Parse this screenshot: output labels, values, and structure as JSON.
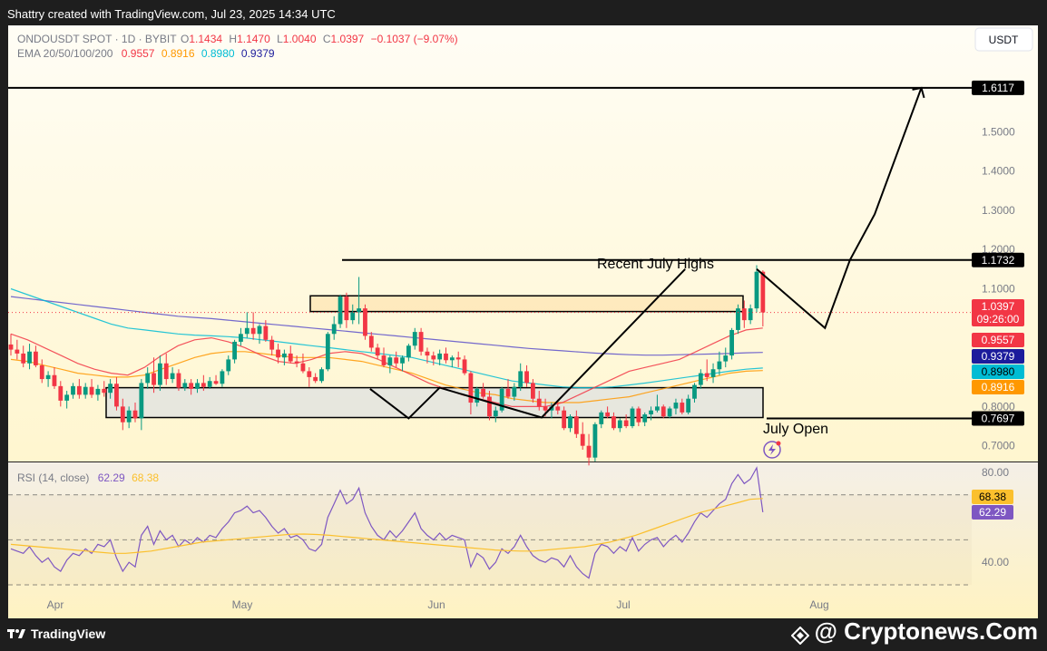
{
  "header": {
    "credit": "Shattry created with TradingView.com, Jul 23, 2025 14:34 UTC"
  },
  "legend": {
    "symbol_line": "ONDOUSDT SPOT · 1D · BYBIT",
    "ohlc": [
      {
        "label": "O",
        "value": "1.1434"
      },
      {
        "label": "H",
        "value": "1.1470"
      },
      {
        "label": "L",
        "value": "1.0040"
      },
      {
        "label": "C",
        "value": "1.0397"
      }
    ],
    "change": "−0.1037 (−9.07%)",
    "ema_label": "EMA 20/50/100/200",
    "ema_values": [
      {
        "value": "0.9557",
        "color": "#f23645"
      },
      {
        "value": "0.8916",
        "color": "#ff9800"
      },
      {
        "value": "0.8980",
        "color": "#00bcd4"
      },
      {
        "value": "0.9379",
        "color": "#1c1c9c"
      }
    ],
    "rsi_label": "RSI (14, close)",
    "rsi_values": [
      {
        "value": "62.29",
        "color": "#7e57c2"
      },
      {
        "value": "68.38",
        "color": "#fbc02d"
      }
    ]
  },
  "currency_button": "USDT",
  "colors": {
    "up": "#089981",
    "down": "#f23645",
    "ema20": "#f23645",
    "ema50": "#ff9800",
    "ema100": "#00bcd4",
    "ema200": "#5b4fc9",
    "rsi": "#7e57c2",
    "rsi_ma": "#fbc02d",
    "resistance_box": "#fde4b3",
    "support_box": "#dfe2e2"
  },
  "annotations": {
    "recent_highs": "Recent July Highs",
    "july_open": "July Open"
  },
  "chart_data": {
    "type": "candlestick",
    "title": "ONDOUSDT SPOT · 1D · BYBIT",
    "x_ticks": [
      "Apr",
      "May",
      "Jun",
      "Jul",
      "Aug"
    ],
    "price_axis": {
      "ticks": [
        "1.5000",
        "1.4000",
        "1.3000",
        "1.2000",
        "1.1000",
        "0.8000",
        "0.7000"
      ],
      "ylim": [
        0.66,
        1.66
      ]
    },
    "price_labels": [
      {
        "value": "1.6117",
        "bg": "#000000",
        "fg": "#ffffff"
      },
      {
        "value": "1.1732",
        "bg": "#000000",
        "fg": "#ffffff"
      },
      {
        "value": "1.0397",
        "bg": "#f23645",
        "fg": "#ffffff",
        "sub": "09:26:00"
      },
      {
        "value": "0.9557",
        "bg": "#f23645",
        "fg": "#ffffff"
      },
      {
        "value": "0.9379",
        "bg": "#1c1c9c",
        "fg": "#ffffff"
      },
      {
        "value": "0.8980",
        "bg": "#00bcd4",
        "fg": "#000000"
      },
      {
        "value": "0.8916",
        "bg": "#ff9800",
        "fg": "#ffffff"
      },
      {
        "value": "0.7697",
        "bg": "#000000",
        "fg": "#ffffff"
      }
    ],
    "horizontal_levels": [
      1.6117,
      1.1732,
      0.7697
    ],
    "zones": [
      {
        "name": "resistance",
        "low": 1.042,
        "high": 1.082
      },
      {
        "name": "support",
        "low": 0.772,
        "high": 0.848
      }
    ],
    "projection_path": [
      {
        "date": "Jul 23",
        "price": 1.15
      },
      {
        "date": "Jul 26",
        "price": 1.0
      },
      {
        "date": "Jul 29",
        "price": 1.1732
      },
      {
        "date": "Aug 2",
        "price": 1.29
      },
      {
        "date": "Aug 5",
        "price": 1.6117
      }
    ],
    "pattern_path": [
      {
        "date": "Jun 1",
        "price": 0.845
      },
      {
        "date": "Jun 7",
        "price": 0.77
      },
      {
        "date": "Jun 12",
        "price": 0.848
      },
      {
        "date": "Jun 28",
        "price": 0.772
      },
      {
        "date": "Jul 21",
        "price": 1.15
      }
    ],
    "rsi_axis": {
      "ticks": [
        "80.00",
        "40.00"
      ],
      "ylim": [
        28,
        82
      ],
      "levels": [
        70,
        50,
        30
      ]
    },
    "rsi_labels": [
      {
        "value": "68.38",
        "bg": "#fbc02d",
        "fg": "#000000"
      },
      {
        "value": "62.29",
        "bg": "#7e57c2",
        "fg": "#ffffff"
      }
    ],
    "candles": [
      [
        0.958,
        0.985,
        0.93,
        0.945
      ],
      [
        0.945,
        0.97,
        0.92,
        0.935
      ],
      [
        0.935,
        0.955,
        0.9,
        0.91
      ],
      [
        0.91,
        0.96,
        0.895,
        0.94
      ],
      [
        0.94,
        0.955,
        0.9,
        0.905
      ],
      [
        0.905,
        0.92,
        0.86,
        0.87
      ],
      [
        0.87,
        0.89,
        0.85,
        0.88
      ],
      [
        0.88,
        0.9,
        0.845,
        0.852
      ],
      [
        0.852,
        0.865,
        0.8,
        0.815
      ],
      [
        0.815,
        0.84,
        0.795,
        0.83
      ],
      [
        0.83,
        0.86,
        0.82,
        0.852
      ],
      [
        0.852,
        0.87,
        0.82,
        0.83
      ],
      [
        0.83,
        0.86,
        0.82,
        0.85
      ],
      [
        0.85,
        0.87,
        0.822,
        0.83
      ],
      [
        0.83,
        0.855,
        0.815,
        0.845
      ],
      [
        0.845,
        0.865,
        0.825,
        0.835
      ],
      [
        0.835,
        0.87,
        0.82,
        0.858
      ],
      [
        0.858,
        0.875,
        0.79,
        0.8
      ],
      [
        0.8,
        0.82,
        0.74,
        0.76
      ],
      [
        0.76,
        0.8,
        0.745,
        0.79
      ],
      [
        0.79,
        0.81,
        0.76,
        0.77
      ],
      [
        0.77,
        0.87,
        0.74,
        0.86
      ],
      [
        0.86,
        0.9,
        0.845,
        0.885
      ],
      [
        0.885,
        0.925,
        0.835,
        0.855
      ],
      [
        0.855,
        0.93,
        0.84,
        0.91
      ],
      [
        0.91,
        0.935,
        0.855,
        0.87
      ],
      [
        0.87,
        0.9,
        0.86,
        0.885
      ],
      [
        0.885,
        0.895,
        0.84,
        0.848
      ],
      [
        0.848,
        0.87,
        0.84,
        0.86
      ],
      [
        0.86,
        0.87,
        0.83,
        0.845
      ],
      [
        0.845,
        0.87,
        0.835,
        0.86
      ],
      [
        0.86,
        0.88,
        0.84,
        0.85
      ],
      [
        0.85,
        0.875,
        0.845,
        0.865
      ],
      [
        0.865,
        0.88,
        0.855,
        0.858
      ],
      [
        0.858,
        0.895,
        0.85,
        0.89
      ],
      [
        0.89,
        0.93,
        0.88,
        0.92
      ],
      [
        0.92,
        0.97,
        0.91,
        0.965
      ],
      [
        0.965,
        1.0,
        0.955,
        0.985
      ],
      [
        0.985,
        1.04,
        0.975,
        1.0
      ],
      [
        1.0,
        1.04,
        0.97,
        0.985
      ],
      [
        0.985,
        1.01,
        0.96,
        1.005
      ],
      [
        1.005,
        1.02,
        0.965,
        0.97
      ],
      [
        0.97,
        0.98,
        0.93,
        0.945
      ],
      [
        0.945,
        0.96,
        0.91,
        0.925
      ],
      [
        0.925,
        0.945,
        0.905,
        0.935
      ],
      [
        0.935,
        0.955,
        0.91,
        0.915
      ],
      [
        0.915,
        0.93,
        0.9,
        0.91
      ],
      [
        0.91,
        0.935,
        0.885,
        0.89
      ],
      [
        0.89,
        0.9,
        0.85,
        0.875
      ],
      [
        0.875,
        0.885,
        0.86,
        0.865
      ],
      [
        0.865,
        0.9,
        0.86,
        0.895
      ],
      [
        0.895,
        0.99,
        0.89,
        0.985
      ],
      [
        0.985,
        1.03,
        0.97,
        1.01
      ],
      [
        1.01,
        1.085,
        1.0,
        1.08
      ],
      [
        1.08,
        1.09,
        1.0,
        1.02
      ],
      [
        1.02,
        1.06,
        1.01,
        1.04
      ],
      [
        1.04,
        1.13,
        1.01,
        1.05
      ],
      [
        1.05,
        1.06,
        0.97,
        0.98
      ],
      [
        0.98,
        0.99,
        0.94,
        0.95
      ],
      [
        0.95,
        0.96,
        0.92,
        0.93
      ],
      [
        0.93,
        0.95,
        0.9,
        0.905
      ],
      [
        0.905,
        0.93,
        0.885,
        0.925
      ],
      [
        0.925,
        0.94,
        0.9,
        0.91
      ],
      [
        0.91,
        0.93,
        0.89,
        0.925
      ],
      [
        0.925,
        0.96,
        0.915,
        0.955
      ],
      [
        0.955,
        1.0,
        0.945,
        0.99
      ],
      [
        0.99,
        1.0,
        0.93,
        0.94
      ],
      [
        0.94,
        0.95,
        0.91,
        0.93
      ],
      [
        0.93,
        0.94,
        0.905,
        0.92
      ],
      [
        0.92,
        0.945,
        0.905,
        0.935
      ],
      [
        0.935,
        0.95,
        0.91,
        0.918
      ],
      [
        0.918,
        0.93,
        0.9,
        0.925
      ],
      [
        0.925,
        0.94,
        0.9,
        0.92
      ],
      [
        0.92,
        0.93,
        0.88,
        0.885
      ],
      [
        0.885,
        0.89,
        0.78,
        0.81
      ],
      [
        0.81,
        0.85,
        0.8,
        0.845
      ],
      [
        0.845,
        0.86,
        0.82,
        0.825
      ],
      [
        0.825,
        0.84,
        0.765,
        0.775
      ],
      [
        0.775,
        0.8,
        0.76,
        0.79
      ],
      [
        0.79,
        0.85,
        0.785,
        0.845
      ],
      [
        0.845,
        0.87,
        0.82,
        0.825
      ],
      [
        0.825,
        0.86,
        0.815,
        0.85
      ],
      [
        0.85,
        0.91,
        0.84,
        0.89
      ],
      [
        0.89,
        0.905,
        0.85,
        0.86
      ],
      [
        0.86,
        0.87,
        0.81,
        0.82
      ],
      [
        0.82,
        0.84,
        0.79,
        0.8
      ],
      [
        0.8,
        0.82,
        0.775,
        0.79
      ],
      [
        0.79,
        0.81,
        0.77,
        0.8
      ],
      [
        0.8,
        0.815,
        0.78,
        0.79
      ],
      [
        0.79,
        0.8,
        0.74,
        0.745
      ],
      [
        0.745,
        0.78,
        0.735,
        0.775
      ],
      [
        0.775,
        0.79,
        0.72,
        0.73
      ],
      [
        0.73,
        0.76,
        0.69,
        0.7
      ],
      [
        0.7,
        0.73,
        0.65,
        0.67
      ],
      [
        0.67,
        0.76,
        0.66,
        0.755
      ],
      [
        0.755,
        0.79,
        0.745,
        0.785
      ],
      [
        0.785,
        0.8,
        0.77,
        0.775
      ],
      [
        0.775,
        0.785,
        0.74,
        0.745
      ],
      [
        0.745,
        0.77,
        0.735,
        0.765
      ],
      [
        0.765,
        0.78,
        0.745,
        0.75
      ],
      [
        0.75,
        0.8,
        0.745,
        0.795
      ],
      [
        0.795,
        0.8,
        0.75,
        0.76
      ],
      [
        0.76,
        0.785,
        0.75,
        0.78
      ],
      [
        0.78,
        0.8,
        0.765,
        0.79
      ],
      [
        0.79,
        0.83,
        0.785,
        0.8
      ],
      [
        0.8,
        0.805,
        0.77,
        0.775
      ],
      [
        0.775,
        0.8,
        0.77,
        0.795
      ],
      [
        0.795,
        0.82,
        0.78,
        0.81
      ],
      [
        0.81,
        0.82,
        0.78,
        0.785
      ],
      [
        0.785,
        0.83,
        0.78,
        0.82
      ],
      [
        0.82,
        0.86,
        0.81,
        0.855
      ],
      [
        0.855,
        0.895,
        0.845,
        0.885
      ],
      [
        0.885,
        0.92,
        0.865,
        0.875
      ],
      [
        0.875,
        0.91,
        0.86,
        0.895
      ],
      [
        0.895,
        0.94,
        0.88,
        0.915
      ],
      [
        0.915,
        0.95,
        0.9,
        0.93
      ],
      [
        0.93,
        1.0,
        0.92,
        0.995
      ],
      [
        0.995,
        1.06,
        0.985,
        1.05
      ],
      [
        1.05,
        1.07,
        1.0,
        1.02
      ],
      [
        1.02,
        1.06,
        1.01,
        1.05
      ],
      [
        1.05,
        1.16,
        1.04,
        1.1434
      ],
      [
        1.1434,
        1.147,
        1.004,
        1.0397
      ]
    ],
    "ema20": [
      0.985,
      0.97,
      0.95,
      0.93,
      0.91,
      0.895,
      0.885,
      0.88,
      0.9,
      0.93,
      0.955,
      0.97,
      0.975,
      0.965,
      0.95,
      0.93,
      0.915,
      0.91,
      0.92,
      0.935,
      0.94,
      0.935,
      0.92,
      0.9,
      0.88,
      0.86,
      0.845,
      0.83,
      0.82,
      0.81,
      0.8,
      0.8,
      0.8,
      0.81,
      0.83,
      0.85,
      0.87,
      0.89,
      0.9,
      0.91,
      0.92,
      0.94,
      0.96,
      0.98,
      0.995,
      1.0
    ],
    "ema50": [
      0.92,
      0.915,
      0.905,
      0.895,
      0.885,
      0.88,
      0.875,
      0.875,
      0.88,
      0.895,
      0.91,
      0.925,
      0.935,
      0.94,
      0.94,
      0.935,
      0.93,
      0.925,
      0.925,
      0.925,
      0.92,
      0.915,
      0.905,
      0.895,
      0.885,
      0.87,
      0.855,
      0.845,
      0.835,
      0.83,
      0.82,
      0.815,
      0.81,
      0.81,
      0.81,
      0.815,
      0.82,
      0.825,
      0.835,
      0.845,
      0.855,
      0.865,
      0.875,
      0.885,
      0.89,
      0.8916
    ],
    "ema100": [
      1.1,
      1.085,
      1.07,
      1.055,
      1.04,
      1.025,
      1.01,
      1.0,
      0.995,
      0.99,
      0.985,
      0.982,
      0.98,
      0.978,
      0.975,
      0.97,
      0.965,
      0.96,
      0.955,
      0.95,
      0.945,
      0.94,
      0.935,
      0.93,
      0.925,
      0.915,
      0.905,
      0.895,
      0.885,
      0.875,
      0.865,
      0.86,
      0.855,
      0.85,
      0.848,
      0.848,
      0.85,
      0.855,
      0.86,
      0.866,
      0.872,
      0.878,
      0.884,
      0.89,
      0.895,
      0.898
    ],
    "ema200": [
      1.08,
      1.075,
      1.07,
      1.065,
      1.06,
      1.055,
      1.05,
      1.045,
      1.04,
      1.035,
      1.03,
      1.027,
      1.024,
      1.02,
      1.016,
      1.012,
      1.008,
      1.004,
      1.0,
      0.996,
      0.992,
      0.988,
      0.984,
      0.98,
      0.976,
      0.972,
      0.968,
      0.964,
      0.96,
      0.956,
      0.952,
      0.948,
      0.945,
      0.942,
      0.939,
      0.936,
      0.934,
      0.932,
      0.931,
      0.931,
      0.932,
      0.933,
      0.934,
      0.935,
      0.937,
      0.9379
    ],
    "rsi": [
      46,
      45,
      44,
      47,
      43,
      40,
      42,
      38,
      36,
      41,
      44,
      43,
      46,
      44,
      48,
      47,
      50,
      42,
      36,
      40,
      38,
      52,
      56,
      48,
      54,
      50,
      52,
      47,
      50,
      48,
      51,
      49,
      52,
      51,
      55,
      58,
      62,
      63,
      65,
      62,
      63,
      60,
      56,
      53,
      55,
      51,
      52,
      50,
      46,
      45,
      48,
      60,
      66,
      72,
      66,
      68,
      73,
      62,
      56,
      52,
      50,
      54,
      51,
      54,
      58,
      62,
      55,
      52,
      50,
      53,
      50,
      52,
      51,
      50,
      38,
      44,
      42,
      37,
      40,
      46,
      44,
      47,
      52,
      47,
      43,
      41,
      40,
      42,
      41,
      38,
      43,
      38,
      35,
      33,
      44,
      48,
      47,
      44,
      47,
      45,
      51,
      45,
      48,
      50,
      51,
      47,
      50,
      52,
      49,
      53,
      58,
      62,
      60,
      63,
      66,
      68,
      75,
      79,
      75,
      77,
      82,
      62.29
    ],
    "rsi_ma": [
      48,
      47.5,
      47,
      46.5,
      46,
      45.5,
      45,
      44.5,
      44,
      44,
      44.5,
      45,
      46,
      47,
      48,
      49,
      49.5,
      50,
      50.5,
      51,
      51.5,
      52,
      52.5,
      52.6,
      52.4,
      52,
      51.5,
      51,
      50.5,
      50,
      49.5,
      49,
      48.5,
      48,
      47.5,
      47,
      46.5,
      46,
      45.5,
      45.2,
      45,
      45,
      45.5,
      46,
      46.5,
      47,
      48,
      49,
      50.5,
      52,
      54,
      56,
      58,
      60,
      62,
      63.5,
      65,
      66.5,
      68,
      68.38
    ]
  },
  "x_axis": {
    "ticks": [
      "Apr",
      "May",
      "Jun",
      "Jul",
      "Aug"
    ]
  },
  "footer": {
    "brand": "TradingView",
    "watermark": "@ Cryptonews.Com"
  }
}
